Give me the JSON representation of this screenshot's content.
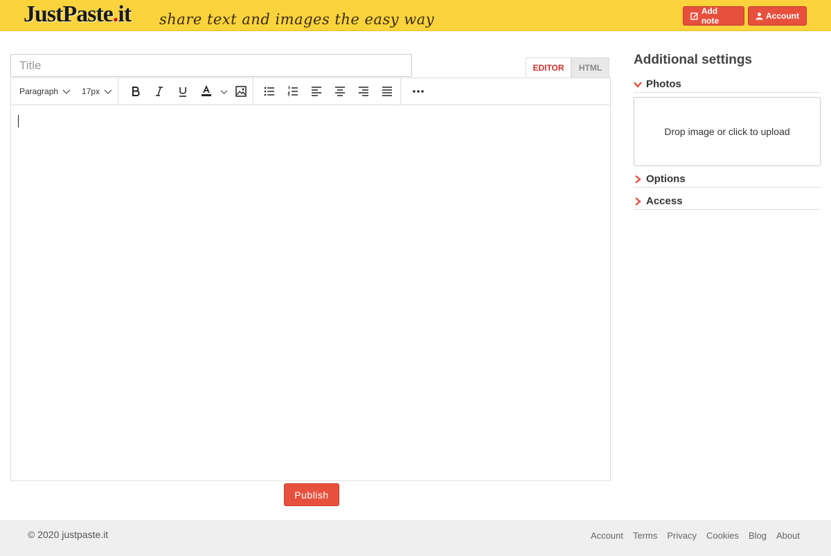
{
  "header": {
    "logo_text": "JustPaste",
    "logo_dot": ".",
    "logo_tld": "it",
    "tagline": "share text and images the easy way",
    "add_note_label": "Add note",
    "account_label": "Account",
    "add_note_icon": "edit-icon",
    "account_icon": "user-icon",
    "brand_color": "#fbd33c",
    "accent_color": "#e8503e"
  },
  "editor": {
    "title_placeholder": "Title",
    "title_value": "",
    "tabs": [
      {
        "label": "EDITOR",
        "active": true
      },
      {
        "label": "HTML",
        "active": false
      }
    ],
    "toolbar": {
      "paragraph_label": "Paragraph",
      "font_size_label": "17px",
      "buttons": [
        "bold-icon",
        "italic-icon",
        "underline-icon",
        "text-color-icon",
        "image-icon",
        "bullet-list-icon",
        "numbered-list-icon",
        "align-left-icon",
        "align-center-icon",
        "align-right-icon",
        "align-justify-icon",
        "more-icon"
      ]
    },
    "content": "",
    "publish_label": "Publish"
  },
  "sidebar": {
    "title": "Additional settings",
    "sections": [
      {
        "label": "Photos",
        "expanded": true,
        "dropzone_text": "Drop image or click to upload"
      },
      {
        "label": "Options",
        "expanded": false
      },
      {
        "label": "Access",
        "expanded": false
      }
    ]
  },
  "footer": {
    "copyright": "© 2020 justpaste.it",
    "links": [
      "Account",
      "Terms",
      "Privacy",
      "Cookies",
      "Blog",
      "About"
    ]
  }
}
